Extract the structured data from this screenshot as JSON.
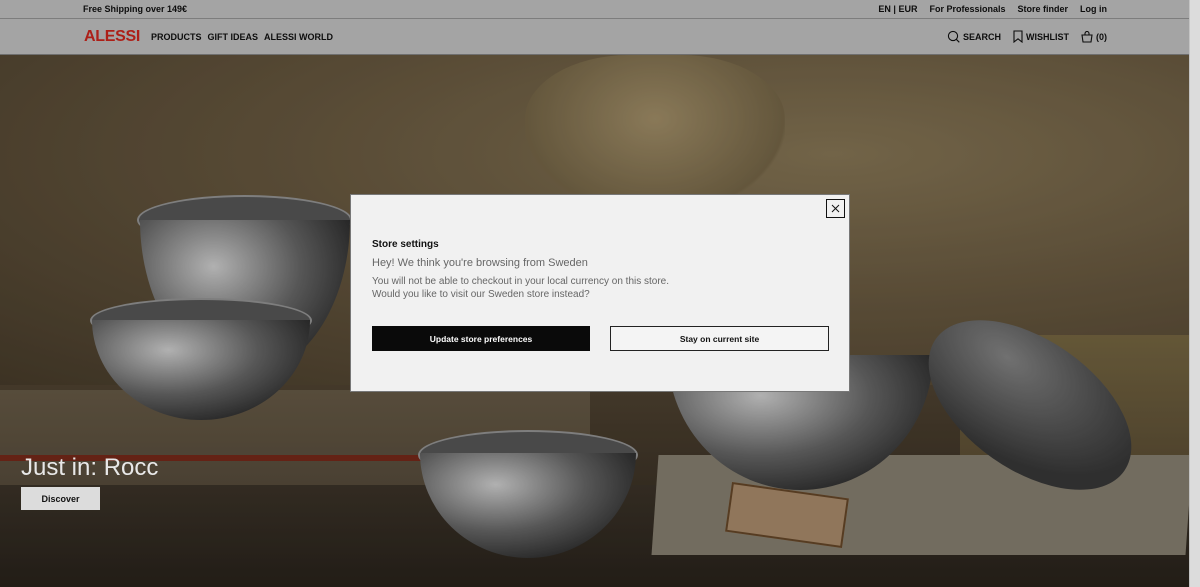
{
  "topbar": {
    "promo": "Free Shipping over 149€",
    "language_currency": "EN | EUR",
    "professionals": "For Professionals",
    "store_finder": "Store finder",
    "login": "Log in"
  },
  "header": {
    "logo": "ALESSI",
    "nav": [
      "PRODUCTS",
      "GIFT IDEAS",
      "ALESSI WORLD"
    ],
    "search_label": "SEARCH",
    "wishlist_label": "WISHLIST",
    "cart_label": "(0)"
  },
  "hero": {
    "title": "Just in: Rocc",
    "cta_label": "Discover"
  },
  "modal": {
    "title": "Store settings",
    "subtitle": "Hey! We think you're browsing from Sweden",
    "body_line1": "You will not be able to checkout in your local currency on this store.",
    "body_line2": "Would you like to visit our Sweden store instead?",
    "primary_button": "Update store preferences",
    "secondary_button": "Stay on current site"
  },
  "colors": {
    "brand_red": "#d3261d",
    "primary_button_bg": "#0a0a0a",
    "header_bg": "#c9c9c9"
  },
  "icons": [
    "search-icon",
    "bookmark-icon",
    "cart-icon",
    "close-icon"
  ]
}
